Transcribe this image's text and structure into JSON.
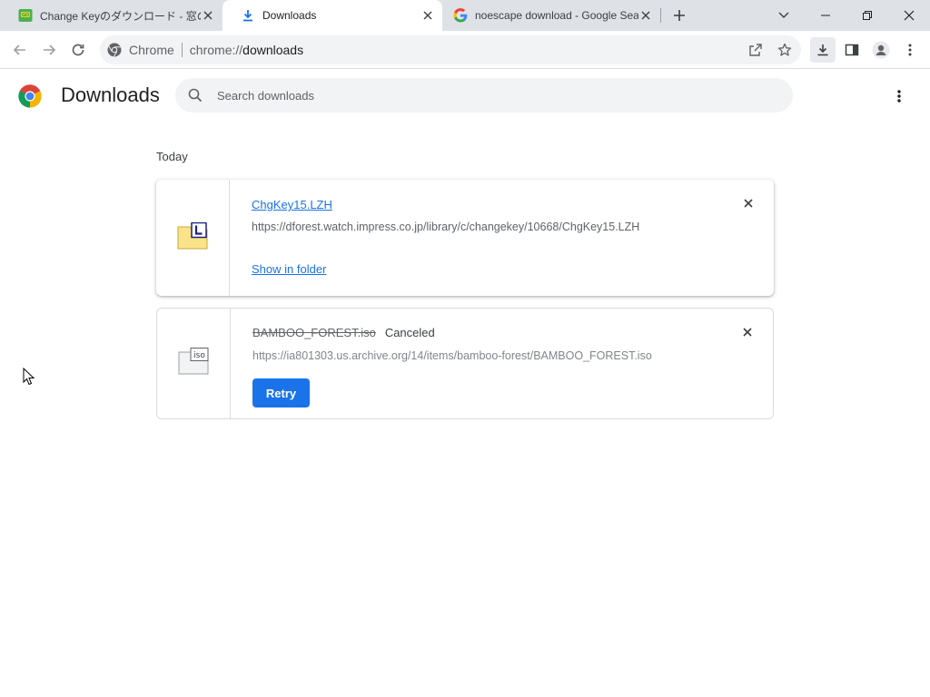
{
  "tabs": [
    {
      "title": "Change Keyのダウンロード - 窓の杜",
      "active": false
    },
    {
      "title": "Downloads",
      "active": true
    },
    {
      "title": "noescape download - Google Sea",
      "active": false
    }
  ],
  "toolbar": {
    "site_label": "Chrome",
    "url_prefix": "chrome://",
    "url_host": "downloads"
  },
  "page": {
    "title": "Downloads",
    "search_placeholder": "Search downloads",
    "date_group": "Today"
  },
  "downloads": [
    {
      "filename": "ChgKey15.LZH",
      "url": "https://dforest.watch.impress.co.jp/library/c/changekey/10668/ChgKey15.LZH",
      "action_label": "Show in folder",
      "icon": "lzh-file-icon"
    },
    {
      "filename": "BAMBOO_FOREST.iso",
      "status": "Canceled",
      "url": "https://ia801303.us.archive.org/14/items/bamboo-forest/BAMBOO_FOREST.iso",
      "action_label": "Retry",
      "icon": "iso-file-icon"
    }
  ],
  "colors": {
    "accent": "#1a73e8",
    "tabstrip": "#dee1e6",
    "omnibox": "#f1f3f4"
  }
}
